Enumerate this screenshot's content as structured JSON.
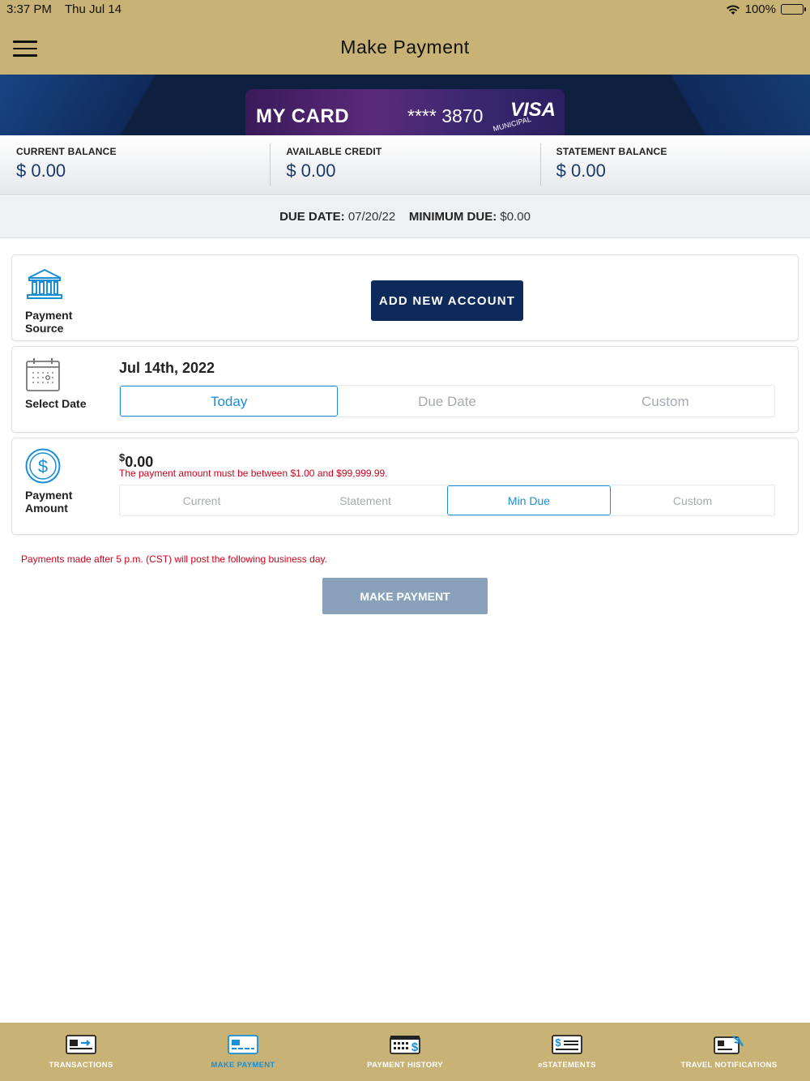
{
  "status": {
    "time": "3:37 PM",
    "date": "Thu Jul 14",
    "battery": "100%"
  },
  "header": {
    "title": "Make Payment"
  },
  "card": {
    "name": "MY CARD",
    "number": "**** 3870",
    "brand": "VISA",
    "seal_text": "MUNICIPAL"
  },
  "balances": [
    {
      "label": "CURRENT BALANCE",
      "value": "$ 0.00"
    },
    {
      "label": "AVAILABLE CREDIT",
      "value": "$ 0.00"
    },
    {
      "label": "STATEMENT BALANCE",
      "value": "$ 0.00"
    }
  ],
  "due": {
    "due_label": "DUE DATE:",
    "due_value": "07/20/22",
    "min_label": "MINIMUM DUE:",
    "min_value": "$0.00"
  },
  "payment_source": {
    "label_line1": "Payment",
    "label_line2": "Source",
    "button": "ADD NEW ACCOUNT"
  },
  "select_date": {
    "label": "Select Date",
    "value": "Jul 14th, 2022",
    "options": [
      "Today",
      "Due Date",
      "Custom"
    ],
    "selected": "Today"
  },
  "payment_amount": {
    "label_line1": "Payment",
    "label_line2": "Amount",
    "currency_symbol": "$",
    "value": "0.00",
    "error": "The payment amount must be between $1.00 and $99,999.99.",
    "options": [
      "Current",
      "Statement",
      "Min Due",
      "Custom"
    ],
    "selected": "Min Due"
  },
  "note": "Payments made after 5 p.m. (CST) will post the following business day.",
  "make_payment_button": "MAKE PAYMENT",
  "tabs": [
    {
      "label": "TRANSACTIONS",
      "icon": "transactions-icon",
      "active": false
    },
    {
      "label": "MAKE PAYMENT",
      "icon": "make-payment-icon",
      "active": true
    },
    {
      "label": "PAYMENT HISTORY",
      "icon": "payment-history-icon",
      "active": false
    },
    {
      "label": "eSTATEMENTS",
      "icon": "estatements-icon",
      "active": false
    },
    {
      "label": "TRAVEL NOTIFICATIONS",
      "icon": "travel-notifications-icon",
      "active": false
    }
  ],
  "colors": {
    "gold": "#c8b275",
    "navy": "#0e2a5a",
    "accent": "#1a8fd6",
    "error": "#d0021b"
  }
}
